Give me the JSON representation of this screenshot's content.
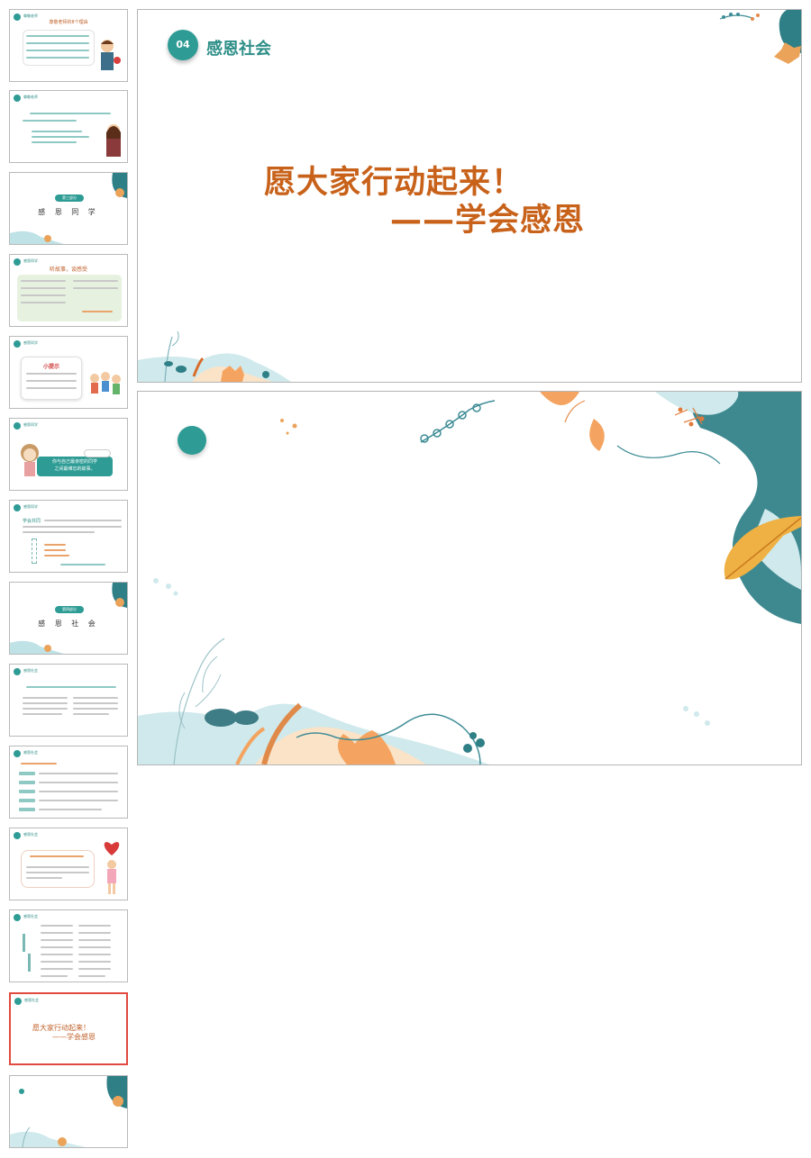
{
  "thumbnails": [
    {
      "id": 1,
      "header": "尊敬老师",
      "title": "尊敬老师的8个理由"
    },
    {
      "id": 2,
      "header": "尊敬老师"
    },
    {
      "id": 3,
      "pill": "第三部分",
      "title": "感 恩 同 学"
    },
    {
      "id": 4,
      "header": "感恩同学",
      "title": "听故事，谈感受"
    },
    {
      "id": 5,
      "header": "感恩同学",
      "title": "小提示"
    },
    {
      "id": 6,
      "header": "感恩同学",
      "caption_1": "你与自己最亲密的同学",
      "caption_2": "之间最难忘的故事。"
    },
    {
      "id": 7,
      "header": "感恩同学",
      "title": "学会共同"
    },
    {
      "id": 8,
      "pill": "第四部分",
      "title": "感 恩 社 会"
    },
    {
      "id": 9,
      "header": "感恩社会"
    },
    {
      "id": 10,
      "header": "感恩社会"
    },
    {
      "id": 11,
      "header": "感恩社会"
    },
    {
      "id": 12,
      "header": "感恩社会"
    },
    {
      "id": 13,
      "header": "感恩社会",
      "line_1": "愿大家行动起来！",
      "line_2": "——学会感恩"
    },
    {
      "id": 14
    }
  ],
  "main_slide": {
    "badge": "04",
    "section_title": "感恩社会",
    "line_1": "愿大家行动起来！",
    "line_2": "——学会感恩"
  },
  "colors": {
    "accent": "#2e9c95",
    "text_orange": "#c8621a",
    "selected_border": "#e04a3f"
  }
}
